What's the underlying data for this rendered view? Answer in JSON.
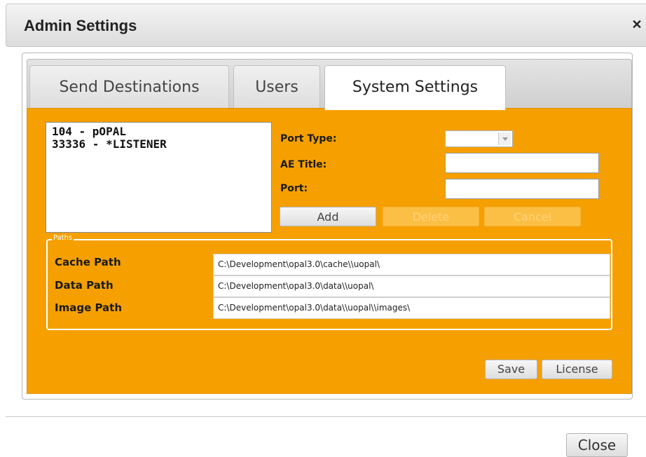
{
  "window": {
    "title": "Admin Settings",
    "close_icon": "close-icon"
  },
  "tabs": [
    {
      "label": "Send Destinations",
      "active": false
    },
    {
      "label": "Users",
      "active": false
    },
    {
      "label": "System Settings",
      "active": true
    }
  ],
  "destinations": {
    "items": [
      "104 - pOPAL",
      "33336 - *LISTENER"
    ]
  },
  "form": {
    "port_type_label": "Port Type:",
    "port_type_value": "",
    "ae_title_label": "AE Title:",
    "ae_title_value": "",
    "port_label": "Port:",
    "port_value": "",
    "add_label": "Add",
    "delete_label": "Delete",
    "cancel_label": "Cancel"
  },
  "paths": {
    "legend": "Paths",
    "cache_label": "Cache Path",
    "cache_value": "C:\\Development\\opal3.0\\cache\\\\uopal\\",
    "data_label": "Data Path",
    "data_value": "C:\\Development\\opal3.0\\data\\\\uopal\\",
    "image_label": "Image Path",
    "image_value": "C:\\Development\\opal3.0\\data\\\\uopal\\\\images\\"
  },
  "actions": {
    "save_label": "Save",
    "license_label": "License"
  },
  "footer": {
    "close_label": "Close"
  },
  "colors": {
    "panel_orange": "#f5a000"
  }
}
